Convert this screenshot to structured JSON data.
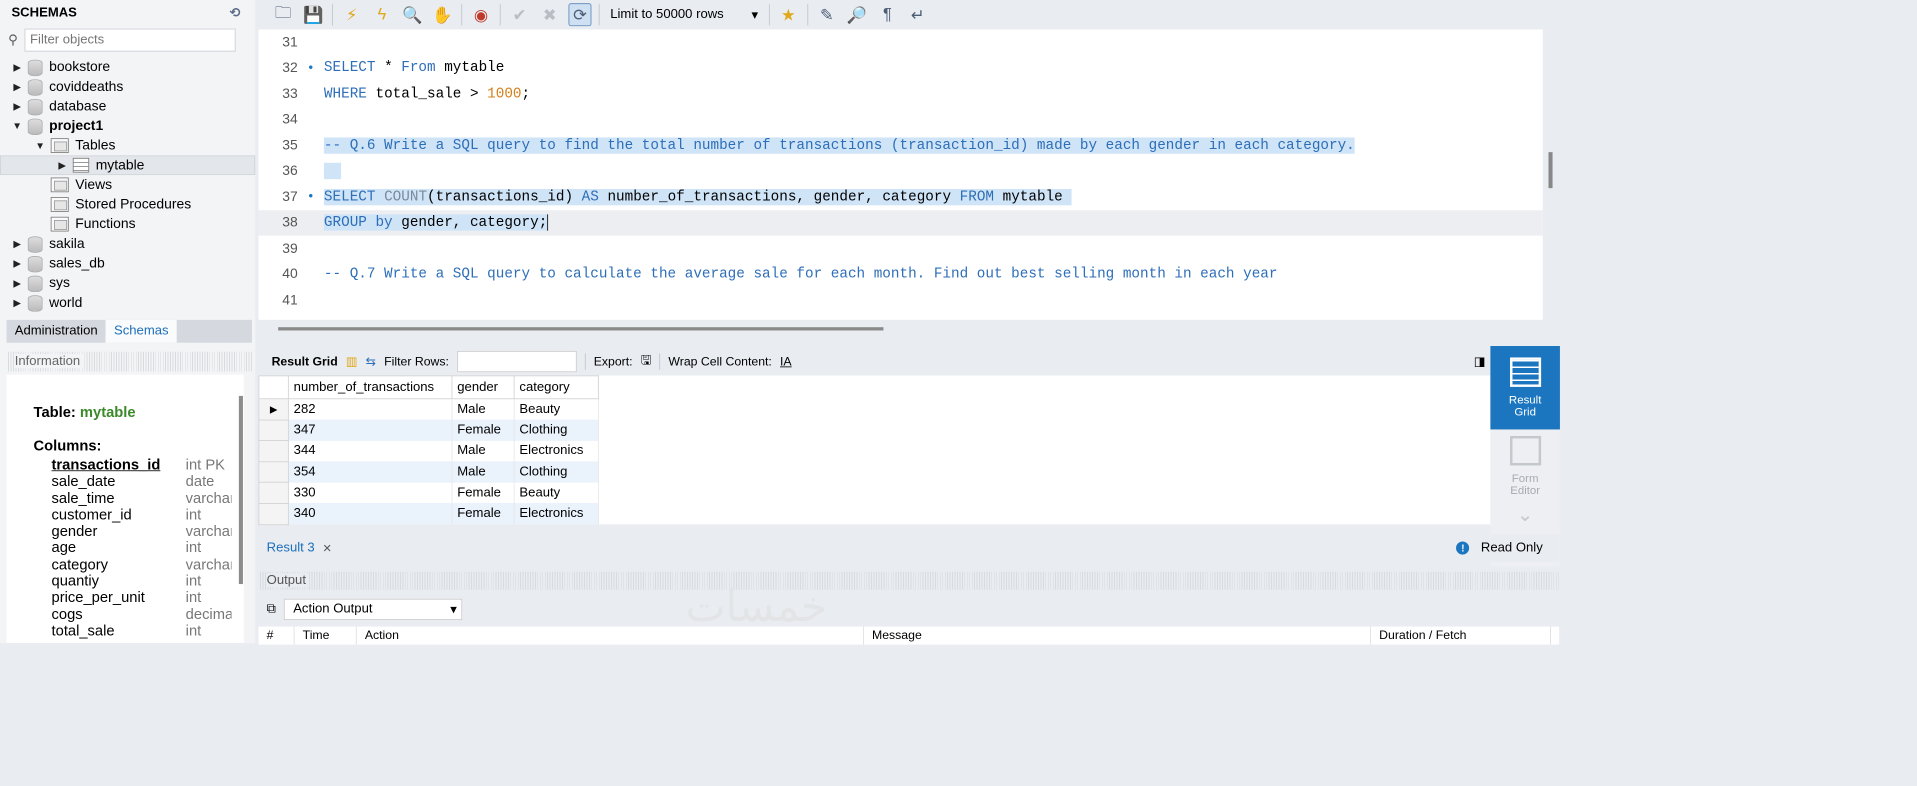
{
  "sidebar": {
    "title": "SCHEMAS",
    "filter_placeholder": "Filter objects",
    "databases": [
      "bookstore",
      "coviddeaths",
      "database",
      "project1",
      "sakila",
      "sales_db",
      "sys",
      "world"
    ],
    "project_children": {
      "tables": "Tables",
      "table_item": "mytable",
      "views": "Views",
      "procedures": "Stored Procedures",
      "functions": "Functions"
    },
    "tabs": [
      "Administration",
      "Schemas"
    ],
    "info_label": "Information",
    "info": {
      "table_prefix": "Table:",
      "table_name": "mytable",
      "columns_label": "Columns:",
      "columns": [
        {
          "name": "transactions_id",
          "type": "int PK"
        },
        {
          "name": "sale_date",
          "type": "date"
        },
        {
          "name": "sale_time",
          "type": "varchar"
        },
        {
          "name": "customer_id",
          "type": "int"
        },
        {
          "name": "gender",
          "type": "varchar"
        },
        {
          "name": "age",
          "type": "int"
        },
        {
          "name": "category",
          "type": "varchar"
        },
        {
          "name": "quantiy",
          "type": "int"
        },
        {
          "name": "price_per_unit",
          "type": "int"
        },
        {
          "name": "cogs",
          "type": "decimal"
        },
        {
          "name": "total_sale",
          "type": "int"
        }
      ]
    }
  },
  "toolbar": {
    "limit_label": "Limit to 50000 rows"
  },
  "editor": {
    "line_numbers": [
      "31",
      "32",
      "33",
      "34",
      "35",
      "36",
      "37",
      "38",
      "39",
      "40",
      "41"
    ],
    "l32": {
      "kw1": "SELECT",
      "mid": " * ",
      "kw2": "From",
      "rest": " mytable"
    },
    "l33": {
      "kw": "WHERE",
      "rest": " total_sale > ",
      "num": "1000",
      "end": ";"
    },
    "l35": "-- Q.6 Write a SQL query to find the total number of transactions (transaction_id) made by each gender in each category.",
    "l37": {
      "kw": "SELECT",
      "fn": "COUNT",
      "a": "(transactions_id) ",
      "as": "AS",
      "b": " number_of_transactions, gender, category ",
      "from": "FROM",
      "c": " mytable"
    },
    "l38": {
      "kw": "GROUP by",
      "rest": " gender, category;"
    },
    "l40": "-- Q.7 Write a SQL query to calculate the average sale for each month. Find out best selling month in each year"
  },
  "result_bar": {
    "grid_label": "Result Grid",
    "filter_label": "Filter Rows:",
    "export_label": "Export:",
    "wrap_label": "Wrap Cell Content:"
  },
  "result": {
    "headers": [
      "number_of_transactions",
      "gender",
      "category"
    ],
    "rows": [
      [
        "282",
        "Male",
        "Beauty"
      ],
      [
        "347",
        "Female",
        "Clothing"
      ],
      [
        "344",
        "Male",
        "Electronics"
      ],
      [
        "354",
        "Male",
        "Clothing"
      ],
      [
        "330",
        "Female",
        "Beauty"
      ],
      [
        "340",
        "Female",
        "Electronics"
      ]
    ]
  },
  "side_panel": {
    "result_grid": "Result Grid",
    "form_editor": "Form Editor"
  },
  "status": {
    "tab": "Result 3",
    "read_only": "Read Only"
  },
  "output": {
    "label": "Output",
    "selector": "Action Output",
    "columns": [
      "#",
      "Time",
      "Action",
      "Message",
      "Duration / Fetch"
    ]
  },
  "watermark": "خمسات"
}
